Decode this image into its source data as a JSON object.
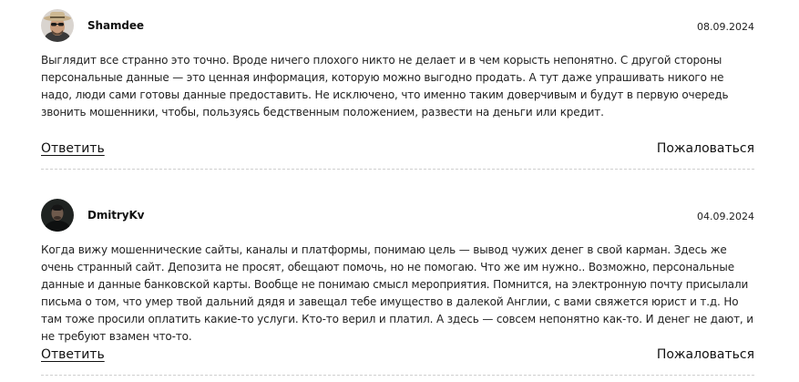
{
  "comments": [
    {
      "author": "Shamdee",
      "date": "08.09.2024",
      "avatar_icon": "user-avatar-hat-sunglasses",
      "text": "Выглядит все странно это точно. Вроде ничего плохого никто не делает и в чем корысть непонятно. С другой стороны персональные данные — это ценная информация, которую можно выгодно продать. А тут даже упрашивать никого не надо, люди сами готовы данные предоставить. Не исключено, что именно таким доверчивым и будут в первую очередь звонить мошенники, чтобы, пользуясь бедственным положением, развести на деньги или кредит.",
      "reply_label": "Ответить",
      "report_label": "Пожаловаться"
    },
    {
      "author": "DmitryKv",
      "date": "04.09.2024",
      "avatar_icon": "user-avatar-dark",
      "text": "Когда вижу мошеннические сайты, каналы и платформы, понимаю цель — вывод чужих денег в свой карман. Здесь же очень странный сайт. Депозита не просят, обещают помочь, но не помогаю. Что же им нужно.. Возможно, персональные данные и данные банковской карты. Вообще не понимаю смысл мероприятия. Помнится, на электронную почту присылали письма о том, что умер твой дальний дядя и завещал тебе имущество в далекой Англии, с вами свяжется юрист и т.д. Но там тоже просили оплатить какие-то услуги. Кто-то верил и платил. А здесь — совсем непонятно как-то. И денег не дают, и не требуют взамен что-то.",
      "reply_label": "Ответить",
      "report_label": "Пожаловаться"
    }
  ]
}
